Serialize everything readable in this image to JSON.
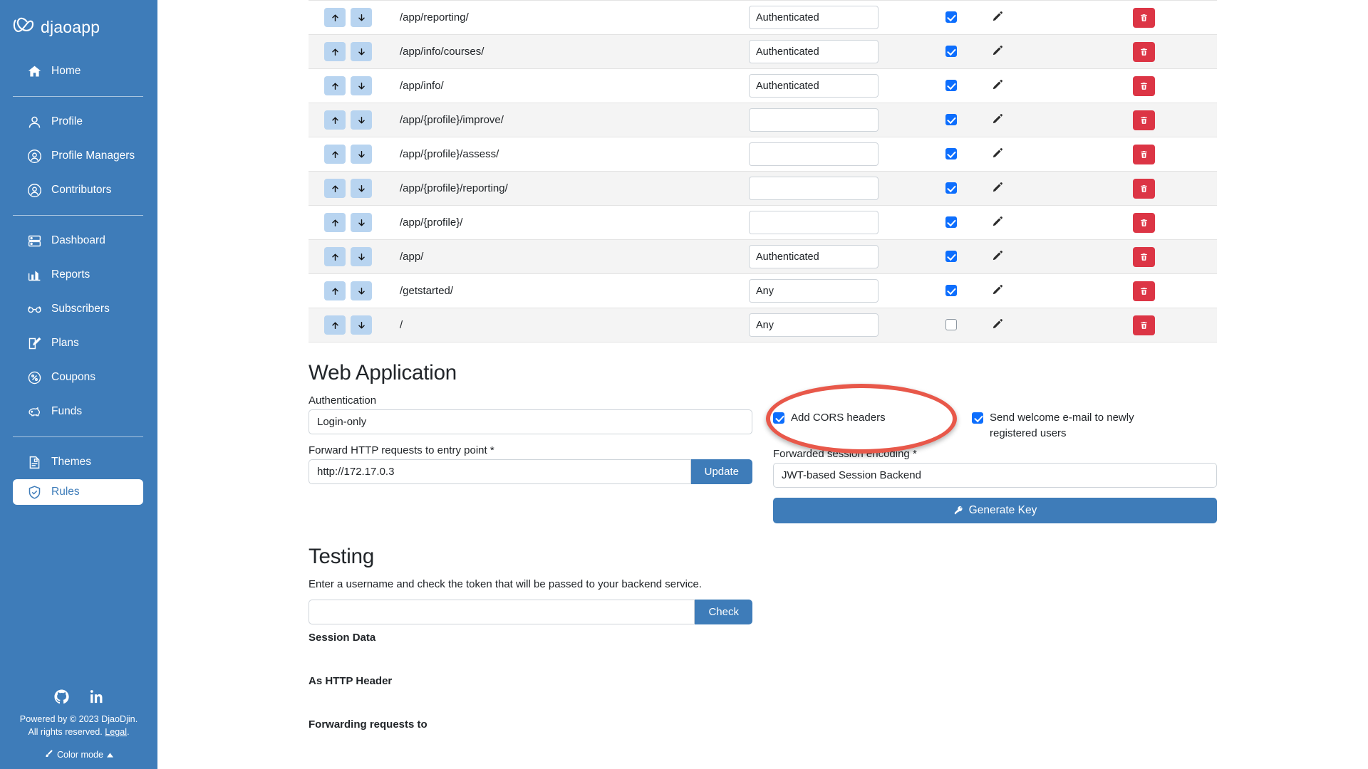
{
  "brand": {
    "name": "djaoapp",
    "logo_icon": "djaodjin-infinity-logo"
  },
  "sidebar": {
    "groups": [
      {
        "items": [
          {
            "label": "Home",
            "icon": "home-icon",
            "active": false
          }
        ]
      },
      {
        "items": [
          {
            "label": "Profile",
            "icon": "user-icon",
            "active": false
          },
          {
            "label": "Profile Managers",
            "icon": "user-circle-icon",
            "active": false
          },
          {
            "label": "Contributors",
            "icon": "user-circle-icon",
            "active": false
          }
        ]
      },
      {
        "items": [
          {
            "label": "Dashboard",
            "icon": "dashboard-icon",
            "active": false
          },
          {
            "label": "Reports",
            "icon": "bar-chart-icon",
            "active": false
          },
          {
            "label": "Subscribers",
            "icon": "glasses-icon",
            "active": false
          },
          {
            "label": "Plans",
            "icon": "pencil-square-icon",
            "active": false
          },
          {
            "label": "Coupons",
            "icon": "percent-circle-icon",
            "active": false
          },
          {
            "label": "Funds",
            "icon": "piggy-bank-icon",
            "active": false
          }
        ]
      },
      {
        "items": [
          {
            "label": "Themes",
            "icon": "document-image-icon",
            "active": false
          },
          {
            "label": "Rules",
            "icon": "shield-check-icon",
            "active": true
          }
        ]
      }
    ],
    "footer": {
      "social": [
        "github-icon",
        "linkedin-icon"
      ],
      "copyright_line1": "Powered by © 2023 DjaoDjin.",
      "copyright_line2_prefix": "All rights reserved. ",
      "legal_link": "Legal",
      "copyright_line2_suffix": ".",
      "color_mode_label": "Color mode",
      "color_mode_icon": "paintbrush-icon",
      "color_mode_caret": "caret-up-icon"
    }
  },
  "rules_table": {
    "move_up_icon": "arrow-up-icon",
    "move_down_icon": "arrow-down-icon",
    "edit_icon": "pencil-icon",
    "delete_icon": "trash-icon",
    "rows": [
      {
        "path": "/app/reporting/",
        "rule": "Authenticated",
        "checked": true
      },
      {
        "path": "/app/info/courses/",
        "rule": "Authenticated",
        "checked": true
      },
      {
        "path": "/app/info/",
        "rule": "Authenticated",
        "checked": true
      },
      {
        "path": "/app/{profile}/improve/",
        "rule": "",
        "checked": true
      },
      {
        "path": "/app/{profile}/assess/",
        "rule": "",
        "checked": true
      },
      {
        "path": "/app/{profile}/reporting/",
        "rule": "",
        "checked": true
      },
      {
        "path": "/app/{profile}/",
        "rule": "",
        "checked": true
      },
      {
        "path": "/app/",
        "rule": "Authenticated",
        "checked": true
      },
      {
        "path": "/getstarted/",
        "rule": "Any",
        "checked": true
      },
      {
        "path": "/",
        "rule": "Any",
        "checked": false
      }
    ]
  },
  "web_application": {
    "heading": "Web Application",
    "authentication_label": "Authentication",
    "authentication_value": "Login-only",
    "forward_label": "Forward HTTP requests to entry point *",
    "forward_value": "http://172.17.0.3",
    "update_button": "Update",
    "cors_label": "Add CORS headers",
    "cors_checked": true,
    "welcome_email_label": "Send welcome e-mail to newly registered users",
    "welcome_email_checked": true,
    "session_encoding_label": "Forwarded session encoding *",
    "session_encoding_value": "JWT-based Session Backend",
    "generate_key_button": "Generate Key",
    "generate_key_icon": "key-icon"
  },
  "testing": {
    "heading": "Testing",
    "description": "Enter a username and check the token that will be passed to your backend service.",
    "username_value": "",
    "username_placeholder": "",
    "check_button": "Check",
    "session_data_label": "Session Data",
    "http_header_label": "As HTTP Header",
    "forwarding_label": "Forwarding requests to"
  },
  "annotation": {
    "type": "ellipse-highlight",
    "target": "Add CORS headers",
    "color": "#e8584a"
  },
  "colors": {
    "sidebar_bg": "#3e7cb9",
    "primary": "#3e7cb9",
    "danger": "#dc3545",
    "checkbox": "#0d6efd",
    "annotation": "#e8584a"
  }
}
